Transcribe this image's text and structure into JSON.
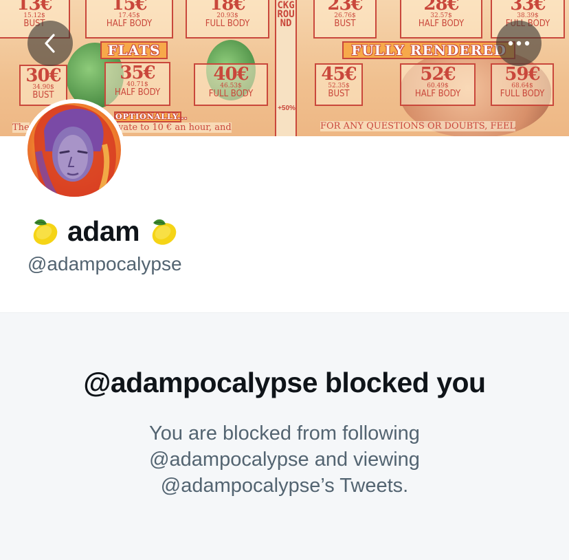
{
  "banner": {
    "strip_text": "CKGROUND",
    "strip_tag": "+50%",
    "left_top": [
      {
        "price": "13€",
        "usd": "15.12$",
        "label": "BUST"
      },
      {
        "price": "15€",
        "usd": "17.45$",
        "label": "HALF BODY"
      },
      {
        "price": "18€",
        "usd": "20.93$",
        "label": "FULL BODY"
      }
    ],
    "left_flats_title": "FLATS",
    "left_flats": [
      {
        "price": "30€",
        "usd": "34.90$",
        "label": "BUST"
      },
      {
        "price": "35€",
        "usd": "40.71$",
        "label": "HALF BODY"
      },
      {
        "price": "40€",
        "usd": "46.53$",
        "label": "FULL BODY"
      }
    ],
    "left_optional_title": "OPTIONALLY...",
    "left_note": "vate to   10 € an hour, and",
    "left_note_prefix": "The",
    "right_top": [
      {
        "price": "23€",
        "usd": "26.76$",
        "label": "BUST"
      },
      {
        "price": "28€",
        "usd": "32.57$",
        "label": "HALF BODY"
      },
      {
        "price": "33€",
        "usd": "38.39$",
        "label": "FULL BODY"
      }
    ],
    "right_rendered_title": "FULLY RENDERED",
    "right_rendered": [
      {
        "price": "45€",
        "usd": "52.35$",
        "label": "BUST"
      },
      {
        "price": "52€",
        "usd": "60.49$",
        "label": "HALF BODY"
      },
      {
        "price": "59€",
        "usd": "68.64$",
        "label": "FULL BODY"
      }
    ],
    "right_note": "FOR ANY QUESTIONS OR DOUBTS, FEEL"
  },
  "profile": {
    "name": "adam",
    "name_emoji": "lemon-icon",
    "handle": "@adampocalypse"
  },
  "blocked": {
    "title": "@adampocalypse blocked you",
    "line1": "You are blocked from following",
    "line2": "@adampocalypse and viewing",
    "line3": "@adampocalypse’s Tweets."
  },
  "colors": {
    "banner_ink": "#c9473b",
    "text_primary": "#0f1419",
    "text_secondary": "#536471",
    "blocked_bg": "#f5f7f9"
  }
}
